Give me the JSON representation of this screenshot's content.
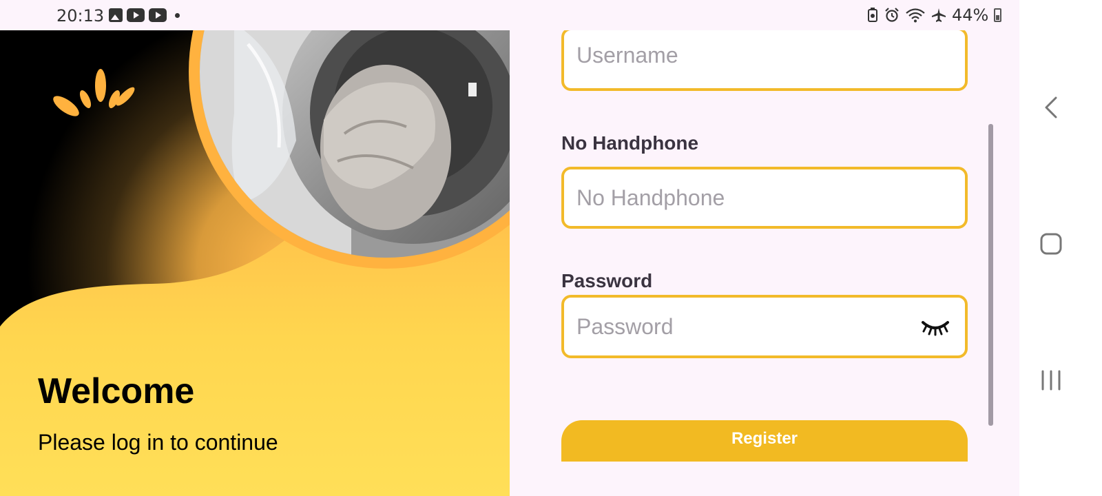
{
  "status_bar": {
    "time": "20:13",
    "left_icons": [
      "image-icon",
      "youtube-icon",
      "youtube-icon",
      "notification-dot"
    ],
    "right_icons": [
      "battery-saver-icon",
      "alarm-icon",
      "wifi-icon",
      "airplane-icon"
    ],
    "battery": "44%"
  },
  "hero": {
    "title": "Welcome",
    "subtitle": "Please log in to continue",
    "logo_icon": "sunburst-logo",
    "image": "laundry-machine-photo"
  },
  "form": {
    "username": {
      "placeholder": "Username",
      "value": ""
    },
    "phone": {
      "label": "No Handphone",
      "placeholder": "No Handphone",
      "value": ""
    },
    "password": {
      "label": "Password",
      "placeholder": "Password",
      "value": "",
      "toggle_icon": "eye-closed-icon"
    },
    "register_label": "Register"
  },
  "nav": {
    "items": [
      "back-icon",
      "home-icon",
      "recents-icon"
    ]
  },
  "colors": {
    "accent": "#f2ba2a",
    "background": "#fdf4fc",
    "hero_yellow": "#ffd84f"
  }
}
